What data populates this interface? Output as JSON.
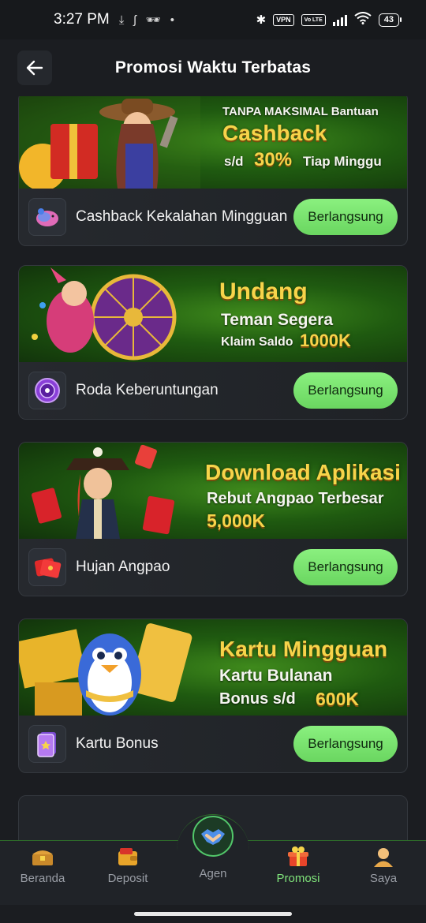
{
  "status_bar": {
    "time": "3:27 PM",
    "vpn": "VPN",
    "lte": "Vo LTE",
    "battery": "43"
  },
  "header": {
    "title": "Promosi Waktu Terbatas",
    "back_icon": "arrow-left-icon"
  },
  "promos": [
    {
      "title": "Cashback Kekalahan Mingguan",
      "status": "Berlangsung",
      "icon": "piggy-bank-icon",
      "banner": {
        "line1": "TANPA MAKSIMAL Bantuan",
        "line2": "Cashback",
        "line3a": "s/d",
        "line3b": "30%",
        "line3c": "Tiap Minggu"
      }
    },
    {
      "title": "Roda Keberuntungan",
      "status": "Berlangsung",
      "icon": "fortune-wheel-icon",
      "banner": {
        "line1": "Undang",
        "line2": "Teman Segera",
        "line3a": "Klaim Saldo",
        "line3b": "1000K"
      }
    },
    {
      "title": "Hujan Angpao",
      "status": "Berlangsung",
      "icon": "red-envelope-icon",
      "banner": {
        "line1": "Download Aplikasi",
        "line2": "Rebut Angpao Terbesar",
        "line3": "5,000K"
      }
    },
    {
      "title": "Kartu Bonus",
      "status": "Berlangsung",
      "icon": "bonus-card-icon",
      "banner": {
        "line1": "Kartu Mingguan",
        "line2": "Kartu Bulanan",
        "line3a": "Bonus s/d",
        "line3b": "600K"
      }
    }
  ],
  "nav": [
    {
      "label": "Beranda",
      "icon": "treasure-chest-icon",
      "active": false
    },
    {
      "label": "Deposit",
      "icon": "wallet-icon",
      "active": false
    },
    {
      "label": "Agen",
      "icon": "handshake-icon",
      "active": false
    },
    {
      "label": "Promosi",
      "icon": "gift-icon",
      "active": true
    },
    {
      "label": "Saya",
      "icon": "user-icon",
      "active": false
    }
  ],
  "colors": {
    "accent_green": "#7fe37a",
    "pill_green": "#6ad660",
    "banner_green": "#2f7a16",
    "gold_text": "#f7d44a"
  }
}
